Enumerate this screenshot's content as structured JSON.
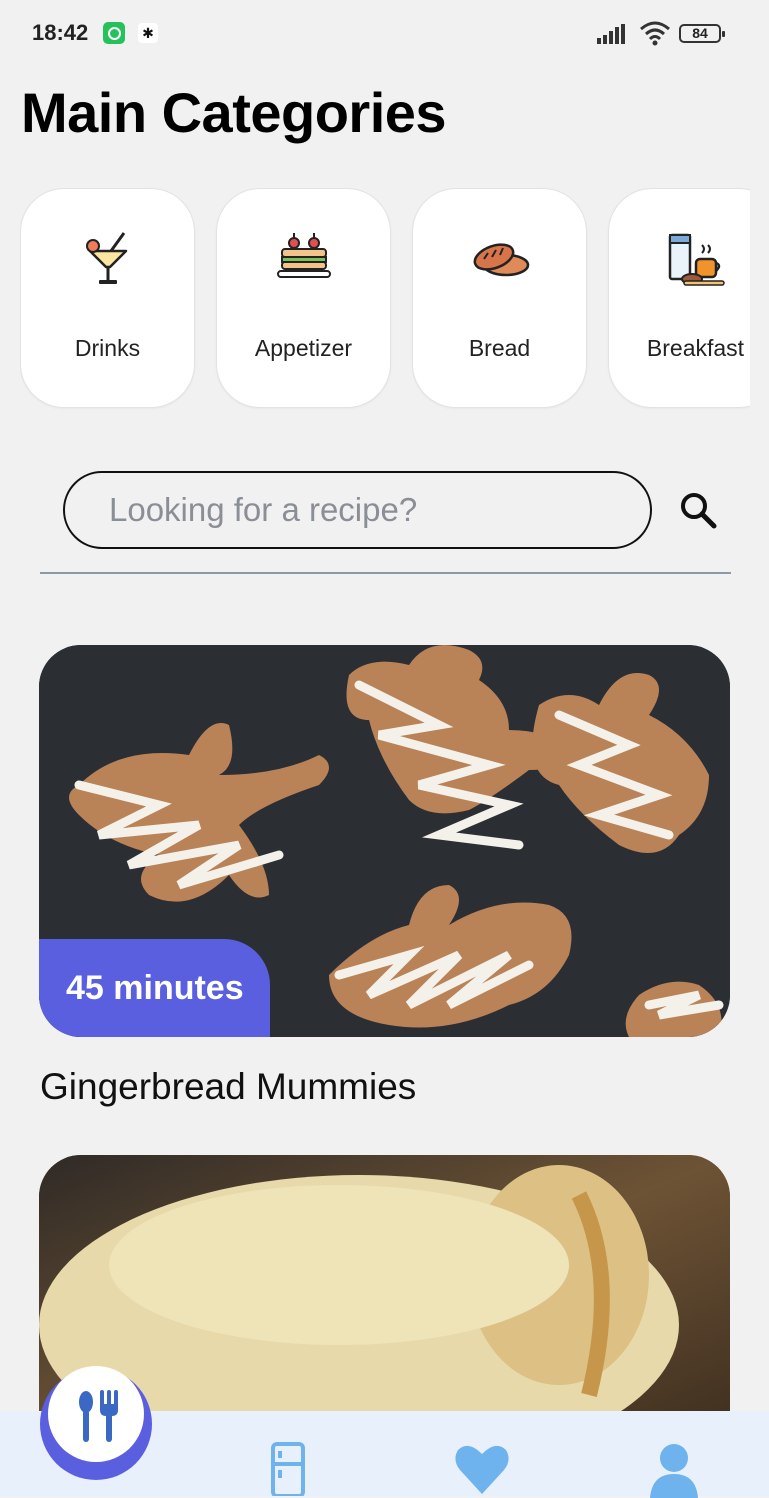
{
  "status_bar": {
    "time": "18:42",
    "battery": "84",
    "icons": [
      "whatsapp-icon",
      "notification-icon",
      "signal-icon",
      "wifi-icon",
      "battery-icon"
    ]
  },
  "header": {
    "title": "Main Categories"
  },
  "categories": [
    {
      "label": "Drinks",
      "icon": "cocktail-icon"
    },
    {
      "label": "Appetizer",
      "icon": "appetizer-icon"
    },
    {
      "label": "Bread",
      "icon": "bread-icon"
    },
    {
      "label": "Breakfast",
      "icon": "breakfast-icon"
    }
  ],
  "search": {
    "placeholder": "Looking for a recipe?",
    "value": "",
    "icon": "search-icon"
  },
  "recipes": [
    {
      "title": "Gingerbread Mummies",
      "time": "45 minutes"
    },
    {
      "title": "",
      "time": ""
    }
  ],
  "bottom_nav": {
    "items": [
      "utensils-icon",
      "fridge-icon",
      "heart-icon",
      "profile-icon"
    ],
    "active": "utensils-icon"
  },
  "colors": {
    "accent": "#5a5fe0",
    "nav_icon": "#6fb3ee",
    "background": "#f1f1f1"
  }
}
